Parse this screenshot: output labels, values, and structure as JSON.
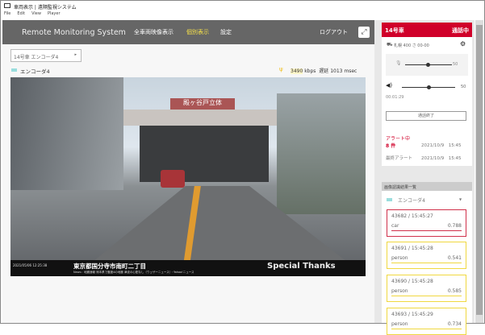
{
  "window": {
    "title": "車両表示 | 遠隔監視システム"
  },
  "menu": [
    "File",
    "Edit",
    "View",
    "Player"
  ],
  "header": {
    "brand": "Remote Monitoring System",
    "nav": [
      "全車両映像表示",
      "個別表示",
      "設定"
    ],
    "active_index": 1,
    "logout": "ログアウト"
  },
  "selector": {
    "value": "14号車 エンコーダ4"
  },
  "stream": {
    "encoder": "エンコーダ4",
    "bitrate": "3490",
    "bitrate_unit": "kbps",
    "latency_label": "遅延",
    "latency": "1013 msec"
  },
  "video": {
    "timestamp": "2021/05/06 12:25:38",
    "location": "東京都国分寺市南町二丁目",
    "news": "News：地震速報 熊本県で震度4の地震 津波の心配なし（ウェザーニュース）・Yahoo!ニュース",
    "sign": "殿ヶ谷戸立体",
    "banner": "Special Thanks"
  },
  "panel": {
    "vehicle": "14号車",
    "status": "通話中",
    "plate": "札幌 400 さ 00-00",
    "mic_value": "50",
    "speaker_value": "50",
    "mic_level": 0.5,
    "speaker_level": 0.5,
    "elapsed": "00:01:29",
    "end_call": "通話終了",
    "alert_label": "アラート中",
    "alert_count": "8 件",
    "alert_time": "2021/10/9　15:45",
    "last_alert_label": "最終アラート",
    "last_alert_time": "2021/10/9　15:45"
  },
  "detections": {
    "title": "画像認識結果一覧",
    "encoder": "エンコーダ4",
    "items": [
      {
        "id": "43682 / 15:45:27",
        "label": "car",
        "score": "0.788",
        "color": "#d0304a"
      },
      {
        "id": "43691 / 15:45:28",
        "label": "person",
        "score": "0.541",
        "color": "#f0d840"
      },
      {
        "id": "43690 / 15:45:28",
        "label": "person",
        "score": "0.585",
        "color": "#f0d840"
      },
      {
        "id": "43693 / 15:45:29",
        "label": "person",
        "score": "0.734",
        "color": "#f0d840"
      }
    ]
  },
  "colors": {
    "accent": "#d0002a",
    "header": "#666666",
    "active_nav": "#f5e04a"
  }
}
